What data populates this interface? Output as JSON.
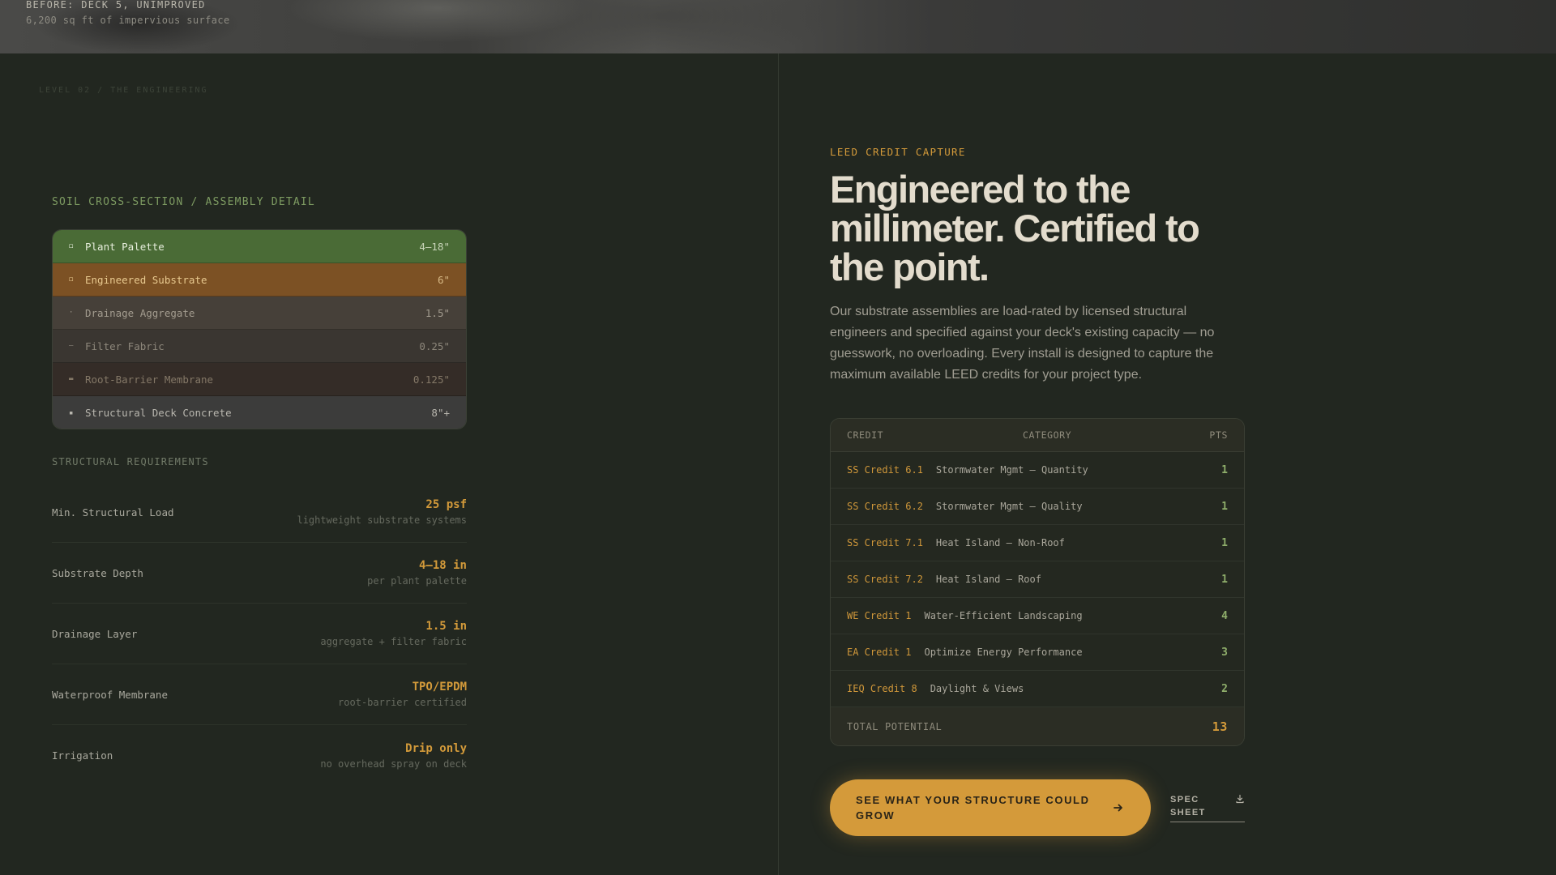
{
  "hero": {
    "caption": "BEFORE: DECK 5, UNIMPROVED",
    "subcaption": "6,200 sq ft of impervious surface"
  },
  "level_label": "LEVEL 02 / THE ENGINEERING",
  "soil": {
    "title": "SOIL CROSS-SECTION / ASSEMBLY DETAIL",
    "layers": [
      {
        "name": "Plant Palette",
        "depth": "4–18\""
      },
      {
        "name": "Engineered Substrate",
        "depth": "6\""
      },
      {
        "name": "Drainage Aggregate",
        "depth": "1.5\""
      },
      {
        "name": "Filter Fabric",
        "depth": "0.25\""
      },
      {
        "name": "Root-Barrier Membrane",
        "depth": "0.125\""
      },
      {
        "name": "Structural Deck Concrete",
        "depth": "8\"+"
      }
    ]
  },
  "structural": {
    "title": "STRUCTURAL REQUIREMENTS",
    "items": [
      {
        "label": "Min. Structural Load",
        "value": "25 psf",
        "note": "lightweight substrate systems"
      },
      {
        "label": "Substrate Depth",
        "value": "4–18 in",
        "note": "per plant palette"
      },
      {
        "label": "Drainage Layer",
        "value": "1.5 in",
        "note": "aggregate + filter fabric"
      },
      {
        "label": "Waterproof Membrane",
        "value": "TPO/EPDM",
        "note": "root-barrier certified"
      },
      {
        "label": "Irrigation",
        "value": "Drip only",
        "note": "no overhead spray on deck"
      }
    ]
  },
  "leed": {
    "eyebrow": "LEED CREDIT CAPTURE",
    "headline": "Engineered to the millimeter. Certified to the point.",
    "body": "Our substrate assemblies are load-rated by licensed structural engineers and specified against your deck's existing capacity — no guesswork, no overloading. Every install is designed to capture the maximum available LEED credits for your project type.",
    "table": {
      "headers": {
        "credit": "CREDIT",
        "category": "CATEGORY",
        "pts": "PTS"
      },
      "rows": [
        {
          "code": "SS Credit 6.1",
          "name": "Stormwater Mgmt — Quantity",
          "pts": "1"
        },
        {
          "code": "SS Credit 6.2",
          "name": "Stormwater Mgmt — Quality",
          "pts": "1"
        },
        {
          "code": "SS Credit 7.1",
          "name": "Heat Island — Non-Roof",
          "pts": "1"
        },
        {
          "code": "SS Credit 7.2",
          "name": "Heat Island — Roof",
          "pts": "1"
        },
        {
          "code": "WE Credit 1",
          "name": "Water-Efficient Landscaping",
          "pts": "4"
        },
        {
          "code": "EA Credit 1",
          "name": "Optimize Energy Performance",
          "pts": "3"
        },
        {
          "code": "IEQ Credit 8",
          "name": "Daylight & Views",
          "pts": "2"
        }
      ],
      "total_label": "TOTAL POTENTIAL",
      "total_value": "13"
    }
  },
  "cta": {
    "label": "SEE WHAT YOUR STRUCTURE COULD GROW",
    "icon": "arrow-right-icon"
  },
  "spec_sheet": {
    "label": "SPEC SHEET",
    "icon": "download-icon"
  },
  "colors": {
    "background": "#222720",
    "accent": "#d39a3a",
    "green": "#7e9c62",
    "plant_layer": "#4a6b36",
    "substrate_layer": "#7c5124"
  }
}
